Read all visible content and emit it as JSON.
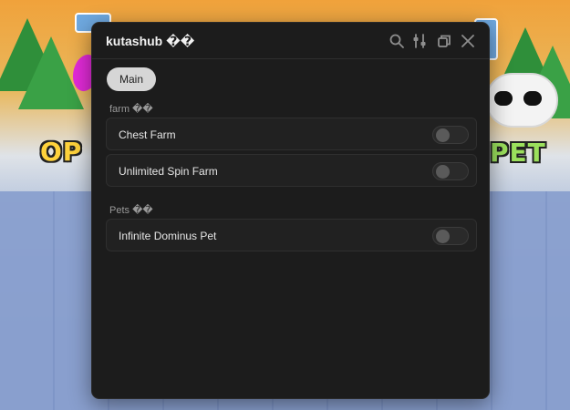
{
  "window": {
    "title": "kutashub ��",
    "icons": [
      "search-icon",
      "sliders-icon",
      "restore-icon",
      "close-icon"
    ]
  },
  "tabs": [
    {
      "label": "Main",
      "selected": true
    }
  ],
  "sections": [
    {
      "label": "farm ��",
      "toggles": [
        {
          "label": "Chest Farm",
          "on": false
        },
        {
          "label": "Unlimited Spin Farm",
          "on": false
        }
      ]
    },
    {
      "label": "Pets ��",
      "toggles": [
        {
          "label": "Infinite Dominus Pet",
          "on": false
        }
      ]
    }
  ],
  "background": {
    "left_sign": "OP P",
    "right_sign": "PET"
  },
  "colors": {
    "window_bg": "#1c1c1c",
    "tab_bg": "#d6d6d6",
    "row_bg": "#212121"
  }
}
